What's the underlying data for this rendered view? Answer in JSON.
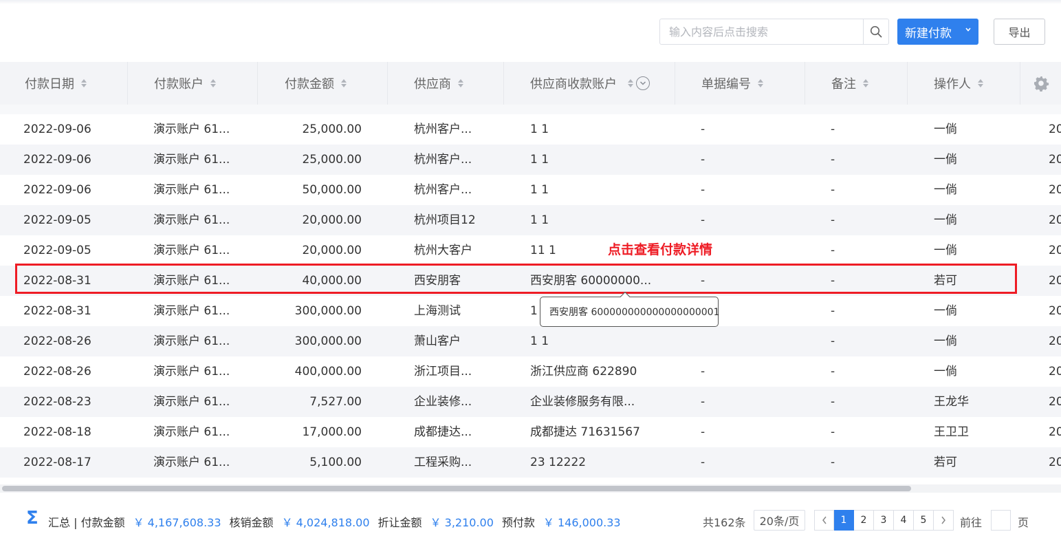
{
  "toolbar": {
    "search_placeholder": "输入内容后点击搜索",
    "new_button_label": "新建付款",
    "export_button_label": "导出"
  },
  "columns": [
    "付款日期",
    "付款账户",
    "付款金额",
    "供应商",
    "供应商收款账户",
    "单据编号",
    "备注",
    "操作人"
  ],
  "rows": [
    {
      "date": "2022-09-06",
      "account": "演示账户 61...",
      "amount": "25,000.00",
      "supplier": "杭州客户...",
      "supplier_account": "1 1",
      "doc_no": "-",
      "remark": "-",
      "operator": "一倘",
      "extra": "20"
    },
    {
      "date": "2022-09-06",
      "account": "演示账户 61...",
      "amount": "25,000.00",
      "supplier": "杭州客户...",
      "supplier_account": "1 1",
      "doc_no": "-",
      "remark": "-",
      "operator": "一倘",
      "extra": "20"
    },
    {
      "date": "2022-09-06",
      "account": "演示账户 61...",
      "amount": "50,000.00",
      "supplier": "杭州客户...",
      "supplier_account": "1 1",
      "doc_no": "-",
      "remark": "-",
      "operator": "一倘",
      "extra": "20"
    },
    {
      "date": "2022-09-05",
      "account": "演示账户 61...",
      "amount": "20,000.00",
      "supplier": "杭州项目12",
      "supplier_account": "1 1",
      "doc_no": "-",
      "remark": "-",
      "operator": "一倘",
      "extra": "20"
    },
    {
      "date": "2022-09-05",
      "account": "演示账户 61...",
      "amount": "20,000.00",
      "supplier": "杭州大客户",
      "supplier_account": "11 1",
      "doc_no": "",
      "remark": "-",
      "operator": "一倘",
      "extra": "20"
    },
    {
      "date": "2022-08-31",
      "account": "演示账户 61...",
      "amount": "40,000.00",
      "supplier": "西安朋客",
      "supplier_account": "西安朋客 60000000...",
      "doc_no": "-",
      "remark": "-",
      "operator": "若可",
      "extra": "20"
    },
    {
      "date": "2022-08-31",
      "account": "演示账户 61...",
      "amount": "300,000.00",
      "supplier": "上海测试",
      "supplier_account": "1",
      "doc_no": "",
      "remark": "-",
      "operator": "一倘",
      "extra": "20"
    },
    {
      "date": "2022-08-26",
      "account": "演示账户 61...",
      "amount": "300,000.00",
      "supplier": "萧山客户",
      "supplier_account": "1 1",
      "doc_no": "",
      "remark": "-",
      "operator": "一倘",
      "extra": "20"
    },
    {
      "date": "2022-08-26",
      "account": "演示账户 61...",
      "amount": "400,000.00",
      "supplier": "浙江项目...",
      "supplier_account": "浙江供应商 622890",
      "doc_no": "-",
      "remark": "-",
      "operator": "一倘",
      "extra": "20"
    },
    {
      "date": "2022-08-23",
      "account": "演示账户 61...",
      "amount": "7,527.00",
      "supplier": "企业装修...",
      "supplier_account": "企业装修服务有限...",
      "doc_no": "-",
      "remark": "-",
      "operator": "王龙华",
      "extra": "20"
    },
    {
      "date": "2022-08-18",
      "account": "演示账户 61...",
      "amount": "17,000.00",
      "supplier": "成都捷达...",
      "supplier_account": "成都捷达 71631567",
      "doc_no": "-",
      "remark": "-",
      "operator": "王卫卫",
      "extra": "20"
    },
    {
      "date": "2022-08-17",
      "account": "演示账户 61...",
      "amount": "5,100.00",
      "supplier": "工程采购...",
      "supplier_account": "23 12222",
      "doc_no": "-",
      "remark": "-",
      "operator": "若可",
      "extra": "20"
    }
  ],
  "annotation": {
    "label": "点击查看付款详情"
  },
  "tooltip": {
    "text": "西安朋客 600000000000000000001"
  },
  "summary": {
    "title": "汇总 | 付款金额",
    "payment_amount": "￥ 4,167,608.33",
    "writeoff_label": "核销金额",
    "writeoff_amount": "￥ 4,024,818.00",
    "discount_label": "折让金额",
    "discount_amount": "￥ 3,210.00",
    "prepaid_label": "预付款",
    "prepaid_amount": "￥ 146,000.33"
  },
  "pagination": {
    "total": "共162条",
    "page_size": "20条/页",
    "pages": [
      "1",
      "2",
      "3",
      "4",
      "5"
    ],
    "current": "1",
    "goto_label": "前往",
    "page_label": "页"
  },
  "colors": {
    "primary": "#2f80ed",
    "highlight": "#ee1c25"
  },
  "icons": {
    "search": "search-icon",
    "dropdown": "chevron-down-icon",
    "settings": "gear-icon",
    "filter": "filter-circle-icon",
    "sum": "sigma-icon"
  }
}
